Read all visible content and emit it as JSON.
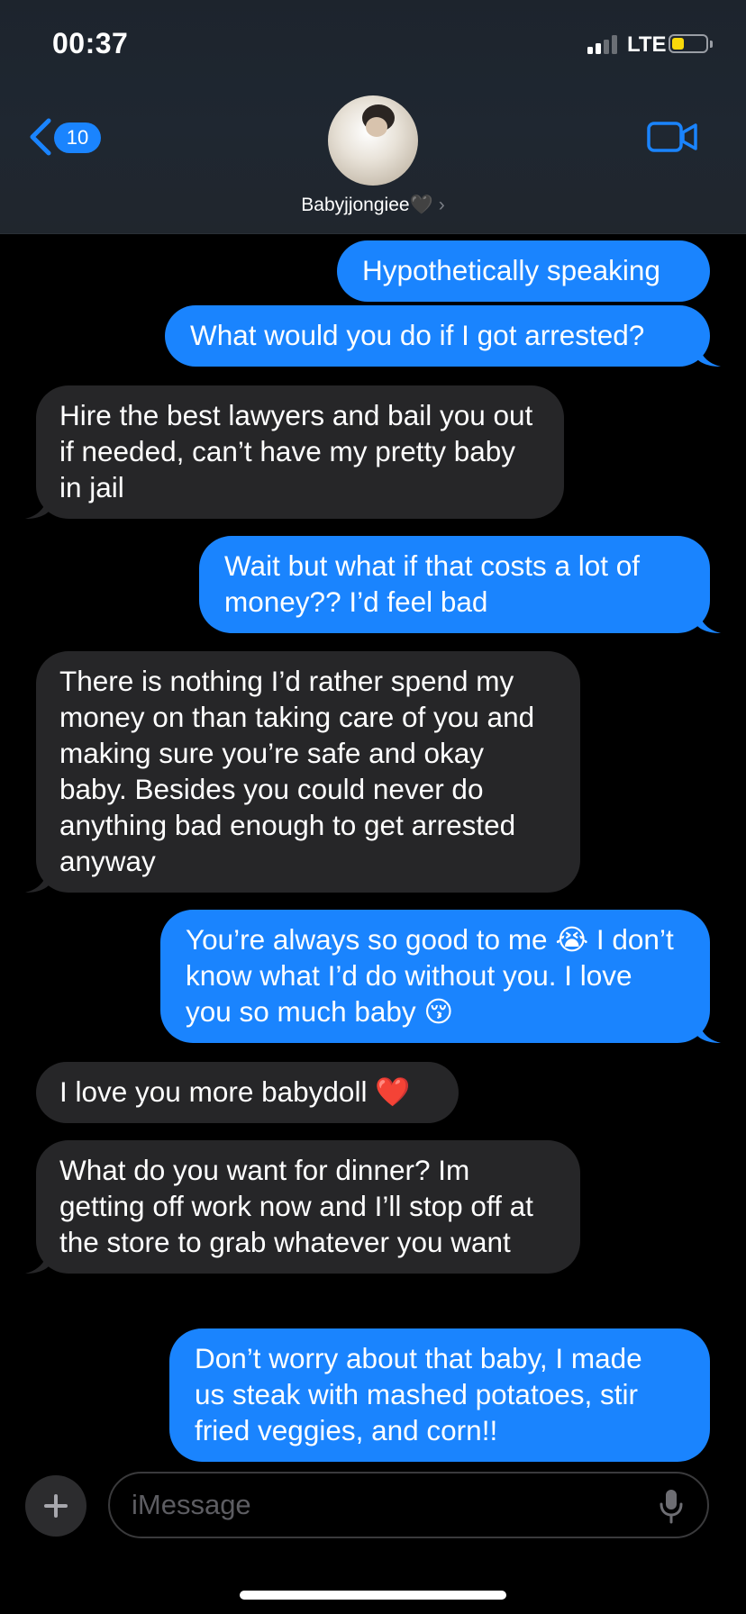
{
  "status_bar": {
    "time": "00:37",
    "network": "LTE",
    "signal_bars_active": 2,
    "signal_bars_total": 4,
    "battery_level": 0.35,
    "battery_color": "#f9d90a"
  },
  "header": {
    "back_count": "10",
    "contact_name": "Babyjjongiee🖤",
    "contact_chevron": "›",
    "accent_color": "#1a84fe"
  },
  "messages": [
    {
      "direction": "outgoing",
      "text": "Hypothetically speaking",
      "tail": false
    },
    {
      "direction": "outgoing",
      "text": "What would you do if I got arrested?",
      "tail": true
    },
    {
      "direction": "incoming",
      "text": "Hire the best lawyers and bail you out if needed, can’t have my pretty baby in jail",
      "tail": true
    },
    {
      "direction": "outgoing",
      "text": "Wait but what if that costs a lot of money?? I’d feel bad",
      "tail": true
    },
    {
      "direction": "incoming",
      "text": "There is nothing I’d rather spend my money on than taking care of you and making sure you’re safe and okay baby. Besides you could never do anything bad enough to get arrested anyway",
      "tail": true
    },
    {
      "direction": "outgoing",
      "text": "You’re always so good to me 😭 I don’t know what I’d do without you. I love you so much baby 😚",
      "tail": true
    },
    {
      "direction": "incoming",
      "text": "I love you more babydoll ❤️",
      "tail": false
    },
    {
      "direction": "incoming",
      "text": "What do you want for dinner? Im getting off work now and I’ll stop off at the store to grab whatever you want",
      "tail": true
    },
    {
      "direction": "outgoing",
      "text": "Don’t worry about that baby, I made us steak with mashed potatoes, stir fried veggies, and corn!!",
      "tail": false
    }
  ],
  "input_bar": {
    "placeholder": "iMessage",
    "value": ""
  },
  "icons": {
    "back": "chevron-left-icon",
    "video": "video-camera-icon",
    "add": "plus-icon",
    "mic": "microphone-icon"
  }
}
